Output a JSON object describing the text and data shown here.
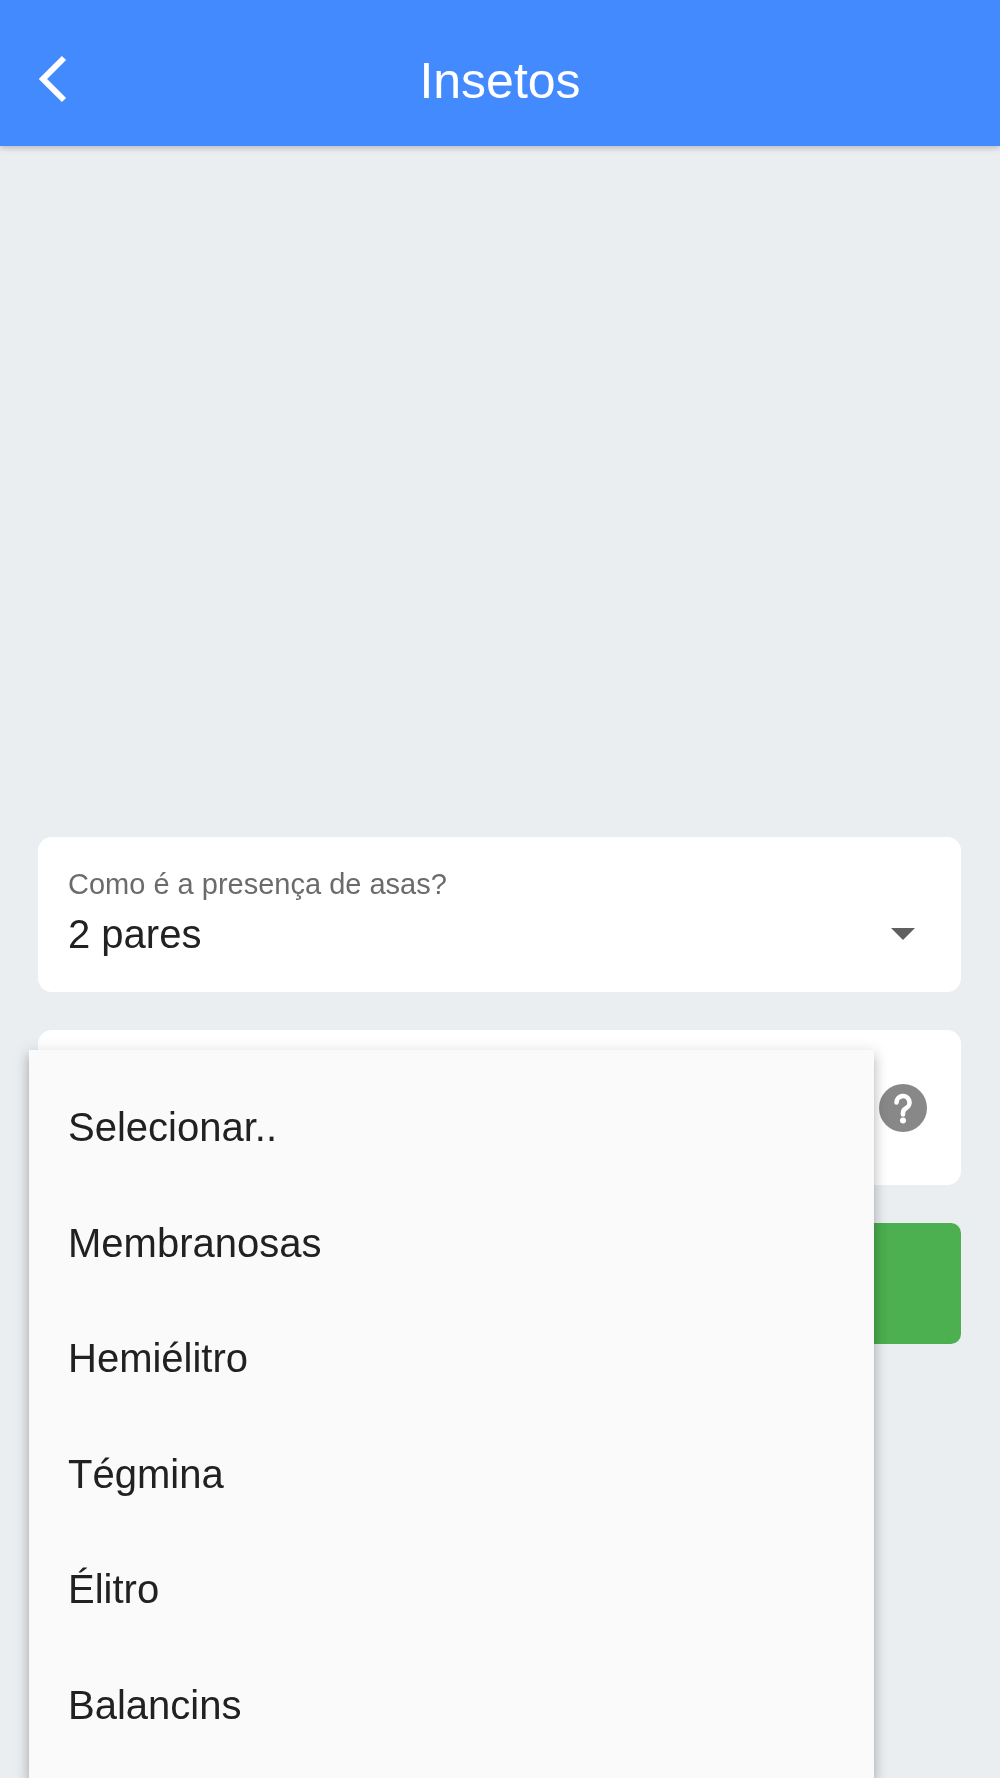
{
  "app_bar": {
    "title": "Insetos"
  },
  "fields": [
    {
      "label": "Como é a presença de asas?",
      "value": "2 pares",
      "help": false
    },
    {
      "help": true
    }
  ],
  "buttons": [
    {
      "kind": "primary"
    }
  ],
  "dropdown_menu": {
    "options": [
      {
        "label": "Selecionar..",
        "selected": false
      },
      {
        "label": "Membranosas",
        "selected": false
      },
      {
        "label": "Hemiélitro",
        "selected": false
      },
      {
        "label": "Tégmina",
        "selected": false
      },
      {
        "label": "Élitro",
        "selected": false
      },
      {
        "label": "Balancins",
        "selected": false
      }
    ]
  }
}
